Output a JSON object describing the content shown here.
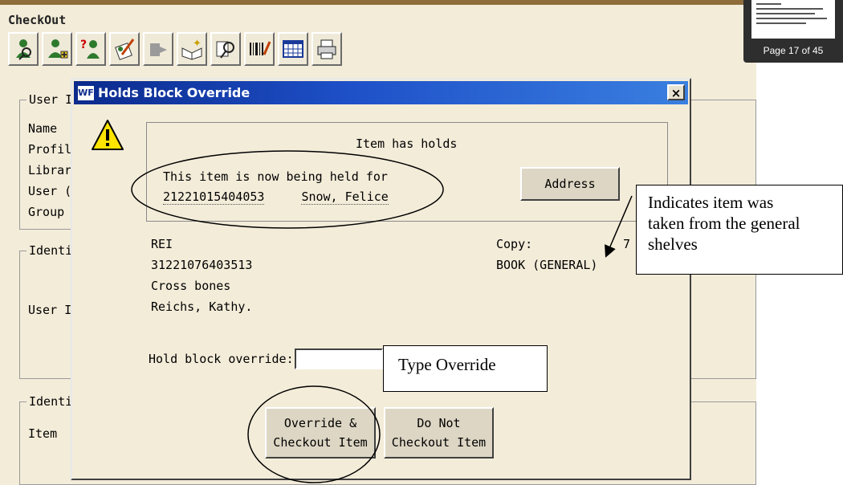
{
  "app": {
    "title": "CheckOut",
    "toolbar": [
      {
        "icon": "user-search-icon"
      },
      {
        "icon": "add-user-icon"
      },
      {
        "icon": "user-question-icon"
      },
      {
        "icon": "edit-user-icon"
      },
      {
        "icon": "disabled-tool-icon"
      },
      {
        "icon": "book-add-icon"
      },
      {
        "icon": "item-search-icon"
      },
      {
        "icon": "barcode-icon"
      },
      {
        "icon": "calendar-icon"
      },
      {
        "icon": "printer-icon"
      }
    ],
    "groups": {
      "user_legend": "User I",
      "user_labels": [
        "Name",
        "Profile",
        "Librar",
        "User (",
        "Group"
      ],
      "ident1_legend": "Identi",
      "ident1_label": "User I",
      "ident2_legend": "Identi",
      "ident2_label": "Item"
    }
  },
  "dialog": {
    "app_icon": "WF",
    "title": "Holds Block Override",
    "close": "×",
    "message": {
      "heading": "Item has holds",
      "line1": "This item is now being held for",
      "holder_id": "21221015404053",
      "holder_name": "Snow, Felice"
    },
    "address_button": "Address",
    "item": {
      "call_number": "REI",
      "barcode": "31221076403513",
      "title": "Cross bones",
      "author": "Reichs, Kathy.",
      "copy_label": "Copy:",
      "copy_value": "7",
      "type": "BOOK (GENERAL)"
    },
    "override_label": "Hold block override:",
    "override_value": "",
    "override_button": [
      "Override &",
      "Checkout Item"
    ],
    "donot_button": [
      "Do Not",
      "Checkout Item"
    ]
  },
  "annotations": {
    "indicates": [
      "Indicates item was",
      "taken from the general",
      "shelves"
    ],
    "type_override": "Type Override"
  },
  "thumbnail": {
    "page_label": "Page 17 of 45"
  }
}
